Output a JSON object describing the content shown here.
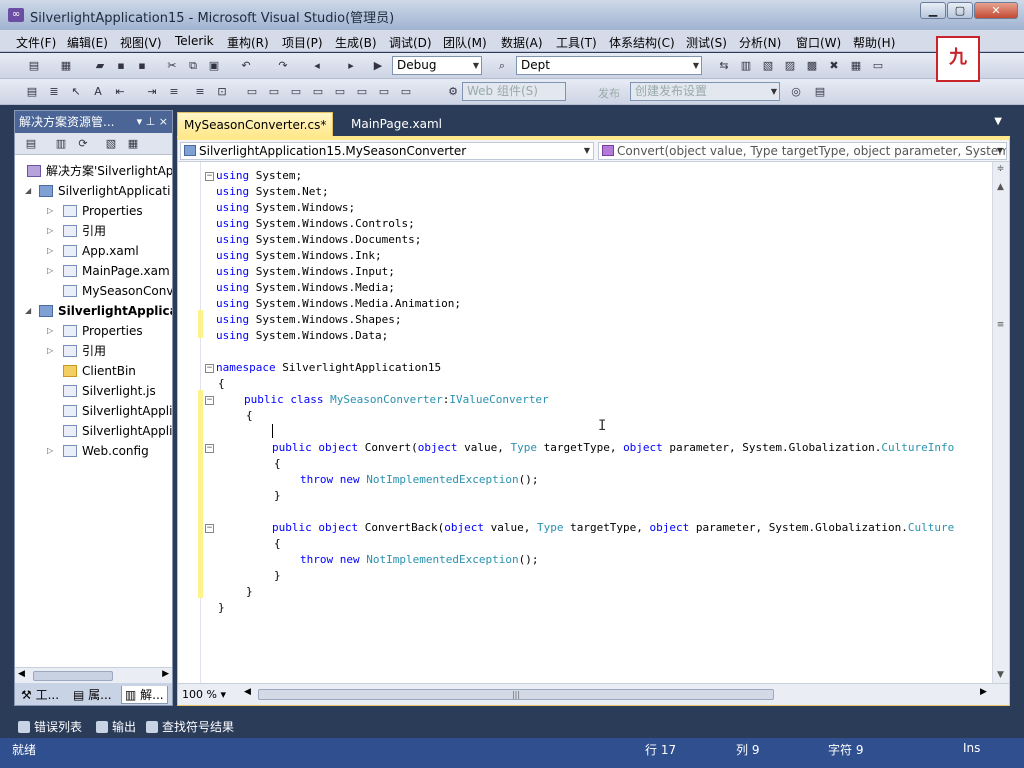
{
  "window": {
    "title": "SilverlightApplication15 - Microsoft Visual Studio(管理员)",
    "min_icon": "minimize-icon",
    "max_icon": "maximize-icon",
    "close_icon": "close-icon"
  },
  "menu": [
    "文件(F)",
    "编辑(E)",
    "视图(V)",
    "Telerik",
    "重构(R)",
    "项目(P)",
    "生成(B)",
    "调试(D)",
    "团队(M)",
    "数据(A)",
    "工具(T)",
    "体系结构(C)",
    "测试(S)",
    "分析(N)",
    "窗口(W)",
    "帮助(H)"
  ],
  "toolbar": {
    "config": "Debug",
    "find": "Dept",
    "web_placeholder": "Web 组件(S)",
    "publish_label": "发布",
    "publish_setting": "创建发布设置"
  },
  "logo": {
    "text": "九"
  },
  "solution": {
    "header": "解决方案资源管...",
    "header_btns": "▾ ⊥ ×",
    "items": [
      {
        "label": "解决方案'SilverlightAp",
        "icon": "solution-icon"
      },
      {
        "label": "SilverlightApplicati",
        "icon": "project-icon"
      },
      {
        "label": "Properties",
        "icon": "properties-icon"
      },
      {
        "label": "引用",
        "icon": "references-icon"
      },
      {
        "label": "App.xaml",
        "icon": "xaml-file-icon"
      },
      {
        "label": "MainPage.xam",
        "icon": "xaml-file-icon"
      },
      {
        "label": "MySeasonConv",
        "icon": "cs-file-icon"
      },
      {
        "label": "SilverlightApplica",
        "icon": "web-project-icon"
      },
      {
        "label": "Properties",
        "icon": "properties-icon"
      },
      {
        "label": "引用",
        "icon": "references-icon"
      },
      {
        "label": "ClientBin",
        "icon": "folder-icon"
      },
      {
        "label": "Silverlight.js",
        "icon": "js-file-icon"
      },
      {
        "label": "SilverlightAppli",
        "icon": "aspx-file-icon"
      },
      {
        "label": "SilverlightAppli",
        "icon": "html-file-icon"
      },
      {
        "label": "Web.config",
        "icon": "config-file-icon"
      }
    ],
    "bottom_tabs": [
      "工...",
      "属...",
      "解..."
    ]
  },
  "tabs": [
    {
      "label": "MySeasonConverter.cs*",
      "active": true
    },
    {
      "label": "MainPage.xaml",
      "active": false
    }
  ],
  "nav": {
    "type_combo": "SilverlightApplication15.MySeasonConverter",
    "member_combo": "Convert(object value, Type targetType, object parameter, System"
  },
  "code": {
    "using_kw": "using",
    "usings": [
      "System;",
      "System.Net;",
      "System.Windows;",
      "System.Windows.Controls;",
      "System.Windows.Documents;",
      "System.Windows.Ink;",
      "System.Windows.Input;",
      "System.Windows.Media;",
      "System.Windows.Media.Animation;",
      "System.Windows.Shapes;",
      "System.Windows.Data;"
    ],
    "ns_kw": "namespace",
    "ns_name": " SilverlightApplication15",
    "open_brace": "{",
    "close_brace": "}",
    "public_kw": "public",
    "class_kw": "class",
    "class_name": "MySeasonConverter",
    "colon": ":",
    "iface": "IValueConverter",
    "object_kw": "object",
    "convert_name": " Convert(",
    "convertback_name": " ConvertBack(",
    "value_param": " value, ",
    "type_kw": "Type",
    "target_param": " targetType, ",
    "param_param": " parameter, System.Globalization.",
    "culture_info": "CultureInfo",
    "culture_trunc": "Culture",
    "throw_kw": "throw",
    "new_kw": "new",
    "exception": "NotImplementedException",
    "call_end": "();"
  },
  "editor": {
    "zoom": "100 %"
  },
  "bottom_tabs": [
    "错误列表",
    "输出",
    "查找符号结果"
  ],
  "status": {
    "ready": "就绪",
    "line": "行 17",
    "col": "列 9",
    "ch": "字符 9",
    "mode": "Ins"
  }
}
